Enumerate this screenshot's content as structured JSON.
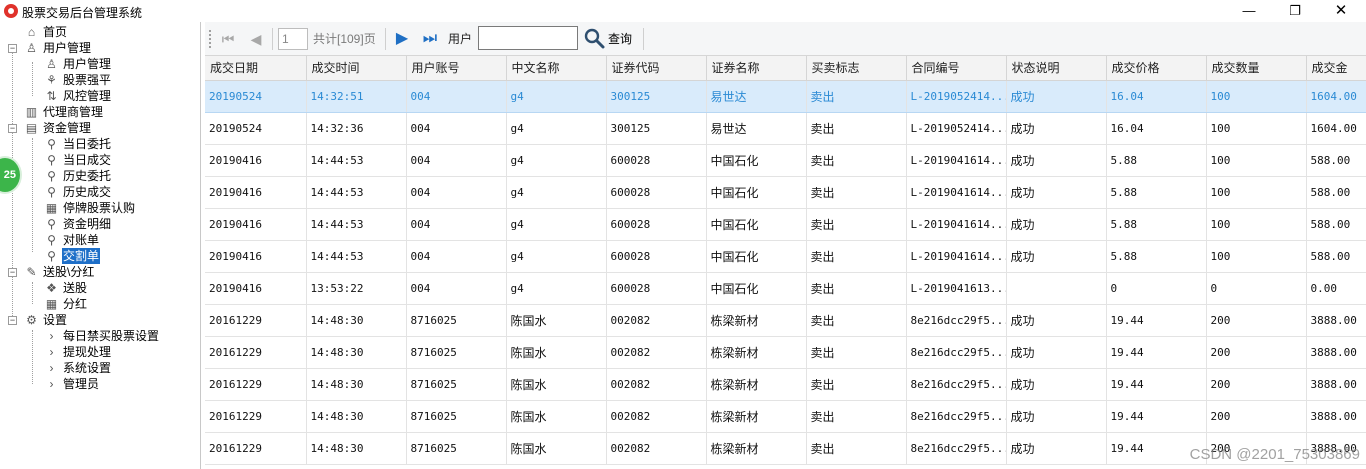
{
  "window": {
    "title": "股票交易后台管理系统",
    "minimize_glyph": "—",
    "maximize_glyph": "❐",
    "close_glyph": "✕"
  },
  "sidebar": {
    "badge": "25",
    "items": [
      {
        "label": "首页",
        "icon": "home-icon"
      },
      {
        "label": "用户管理",
        "icon": "user-icon"
      },
      {
        "label": "用户管理",
        "icon": "user-icon"
      },
      {
        "label": "股票强平",
        "icon": "stock-icon"
      },
      {
        "label": "风控管理",
        "icon": "risk-icon"
      },
      {
        "label": "代理商管理",
        "icon": "agent-icon"
      },
      {
        "label": "资金管理",
        "icon": "funds-icon"
      },
      {
        "label": "当日委托",
        "icon": "search-icon"
      },
      {
        "label": "当日成交",
        "icon": "search-icon"
      },
      {
        "label": "历史委托",
        "icon": "search-icon"
      },
      {
        "label": "历史成交",
        "icon": "search-icon"
      },
      {
        "label": "停牌股票认购",
        "icon": "calendar-icon"
      },
      {
        "label": "资金明细",
        "icon": "search-icon"
      },
      {
        "label": "对账单",
        "icon": "search-icon"
      },
      {
        "label": "交割单",
        "icon": "search-icon"
      },
      {
        "label": "送股\\分红",
        "icon": "edit-icon"
      },
      {
        "label": "送股",
        "icon": "gift-icon"
      },
      {
        "label": "分红",
        "icon": "grid-icon"
      },
      {
        "label": "设置",
        "icon": "gear-icon"
      },
      {
        "label": "每日禁买股票设置",
        "icon": "chevron-right-icon"
      },
      {
        "label": "提现处理",
        "icon": "chevron-right-icon"
      },
      {
        "label": "系统设置",
        "icon": "chevron-right-icon"
      },
      {
        "label": "管理员",
        "icon": "chevron-right-icon"
      }
    ]
  },
  "toolbar": {
    "page_value": "1",
    "page_total": "共计[109]页",
    "user_label": "用户",
    "user_value": "",
    "search_label": "查询"
  },
  "table": {
    "columns": [
      "成交日期",
      "成交时间",
      "用户账号",
      "中文名称",
      "证券代码",
      "证券名称",
      "买卖标志",
      "合同编号",
      "状态说明",
      "成交价格",
      "成交数量",
      "成交金"
    ],
    "rows": [
      [
        "20190524",
        "14:32:51",
        "004",
        "g4",
        "300125",
        "易世达",
        "卖出",
        "L-2019052414...",
        "成功",
        "16.04",
        "100",
        "1604.00"
      ],
      [
        "20190524",
        "14:32:36",
        "004",
        "g4",
        "300125",
        "易世达",
        "卖出",
        "L-2019052414...",
        "成功",
        "16.04",
        "100",
        "1604.00"
      ],
      [
        "20190416",
        "14:44:53",
        "004",
        "g4",
        "600028",
        "中国石化",
        "卖出",
        "L-2019041614...",
        "成功",
        "5.88",
        "100",
        "588.00"
      ],
      [
        "20190416",
        "14:44:53",
        "004",
        "g4",
        "600028",
        "中国石化",
        "卖出",
        "L-2019041614...",
        "成功",
        "5.88",
        "100",
        "588.00"
      ],
      [
        "20190416",
        "14:44:53",
        "004",
        "g4",
        "600028",
        "中国石化",
        "卖出",
        "L-2019041614...",
        "成功",
        "5.88",
        "100",
        "588.00"
      ],
      [
        "20190416",
        "14:44:53",
        "004",
        "g4",
        "600028",
        "中国石化",
        "卖出",
        "L-2019041614...",
        "成功",
        "5.88",
        "100",
        "588.00"
      ],
      [
        "20190416",
        "13:53:22",
        "004",
        "g4",
        "600028",
        "中国石化",
        "卖出",
        "L-2019041613...",
        "",
        "0",
        "0",
        "0.00"
      ],
      [
        "20161229",
        "14:48:30",
        "8716025",
        "陈国水",
        "002082",
        "栋梁新材",
        "卖出",
        "8e216dcc29f5...",
        "成功",
        "19.44",
        "200",
        "3888.00"
      ],
      [
        "20161229",
        "14:48:30",
        "8716025",
        "陈国水",
        "002082",
        "栋梁新材",
        "卖出",
        "8e216dcc29f5...",
        "成功",
        "19.44",
        "200",
        "3888.00"
      ],
      [
        "20161229",
        "14:48:30",
        "8716025",
        "陈国水",
        "002082",
        "栋梁新材",
        "卖出",
        "8e216dcc29f5...",
        "成功",
        "19.44",
        "200",
        "3888.00"
      ],
      [
        "20161229",
        "14:48:30",
        "8716025",
        "陈国水",
        "002082",
        "栋梁新材",
        "卖出",
        "8e216dcc29f5...",
        "成功",
        "19.44",
        "200",
        "3888.00"
      ],
      [
        "20161229",
        "14:48:30",
        "8716025",
        "陈国水",
        "002082",
        "栋梁新材",
        "卖出",
        "8e216dcc29f5...",
        "成功",
        "19.44",
        "200",
        "3888.00"
      ]
    ]
  },
  "watermark": "CSDN @2201_75303869"
}
